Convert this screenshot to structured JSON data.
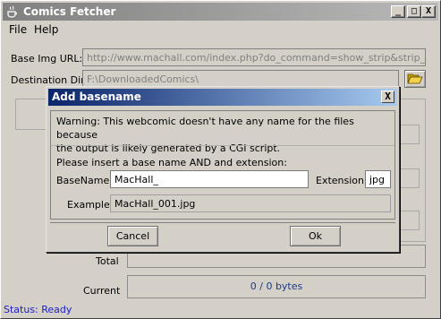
{
  "window": {
    "title": "Comics Fetcher",
    "controls": {
      "minimize": "_",
      "maximize": "□",
      "close": "X"
    }
  },
  "menu": [
    "File",
    "Help"
  ],
  "form": {
    "base_img_url_label": "Base Img URL:",
    "base_img_url_value": "http://www.machall.com/index.php?do_command=show_strip&strip_i",
    "dest_dir_label": "Destination Dir:",
    "dest_dir_value": "F:\\DownloadedComics\\",
    "folder_icon": "folder-open-icon"
  },
  "progress": {
    "total_label": "Total",
    "current_label": "Current",
    "current_value": "0 / 0 bytes"
  },
  "status": "Status: Ready",
  "dialog": {
    "title": "Add basename",
    "close_label": "X",
    "warning_line1": "Warning: This webcomic doesn't have any name for the files because",
    "warning_line2": "the output is likely generated by a CGI script.",
    "instruction": "Please insert a base name AND and extension:",
    "basename_label": "BaseName:",
    "basename_value": "MacHall_",
    "extension_label": "Extension:",
    "extension_value": "jpg",
    "example_label": "Example:",
    "example_value": "MacHall_001.jpg",
    "cancel_label": "Cancel",
    "ok_label": "Ok"
  },
  "colors": {
    "dialog_title_start": "#0a246a",
    "dialog_title_end": "#a6caf0",
    "status_text": "#1c1ccc",
    "progress_text": "#1a3b8f"
  }
}
